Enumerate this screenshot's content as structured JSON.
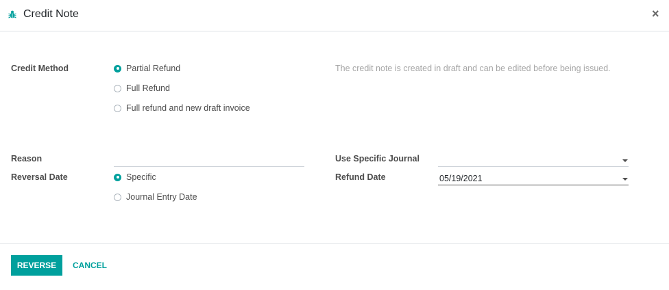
{
  "dialog": {
    "title": "Credit Note",
    "close_symbol": "×"
  },
  "credit_method": {
    "label": "Credit Method",
    "options": [
      "Partial Refund",
      "Full Refund",
      "Full refund and new draft invoice"
    ],
    "selected": "Partial Refund",
    "help_text": "The credit note is created in draft and can be edited before being issued."
  },
  "reason": {
    "label": "Reason",
    "value": ""
  },
  "reversal_date": {
    "label": "Reversal Date",
    "options": [
      "Specific",
      "Journal Entry Date"
    ],
    "selected": "Specific"
  },
  "journal": {
    "label": "Use Specific Journal",
    "value": ""
  },
  "refund_date": {
    "label": "Refund Date",
    "value": "05/19/2021"
  },
  "footer": {
    "reverse_label": "REVERSE",
    "cancel_label": "CANCEL"
  },
  "colors": {
    "accent": "#00a09d"
  }
}
